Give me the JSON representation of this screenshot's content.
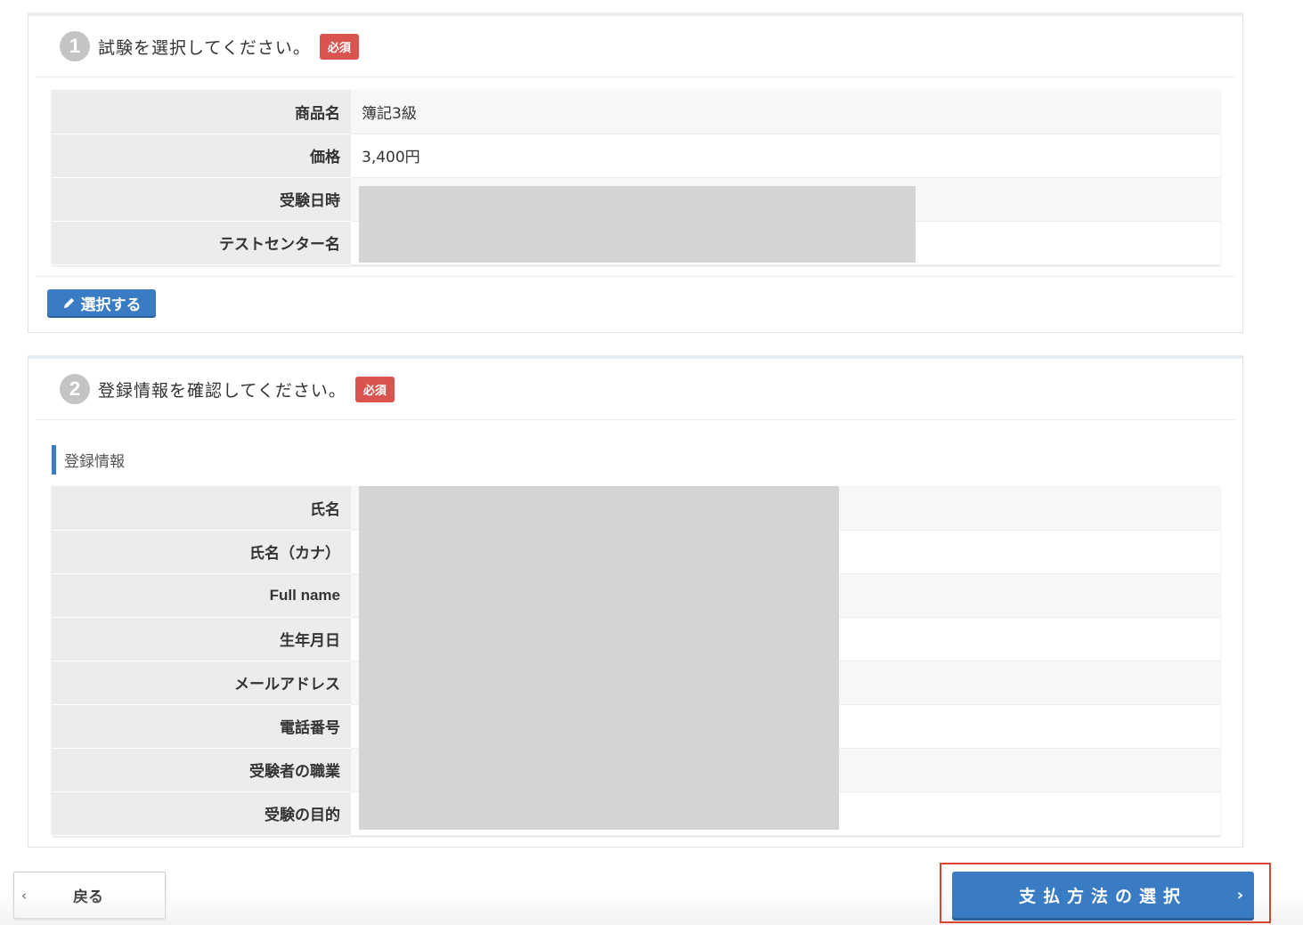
{
  "section1": {
    "step": "1",
    "title": "試験を選択してください。",
    "required": "必須",
    "rows": [
      {
        "label": "商品名",
        "value": "簿記3級"
      },
      {
        "label": "価格",
        "value": "3,400円"
      },
      {
        "label": "受験日時",
        "value": ""
      },
      {
        "label": "テストセンター名",
        "value": ""
      }
    ],
    "select_button": "選択する"
  },
  "section2": {
    "step": "2",
    "title": "登録情報を確認してください。",
    "required": "必須",
    "subheading": "登録情報",
    "rows": [
      {
        "label": "氏名"
      },
      {
        "label": "氏名（カナ）"
      },
      {
        "label": "Full name"
      },
      {
        "label": "生年月日"
      },
      {
        "label": "メールアドレス"
      },
      {
        "label": "電話番号"
      },
      {
        "label": "受験者の職業"
      },
      {
        "label": "受験の目的"
      }
    ]
  },
  "footer": {
    "back_label": "戻る",
    "pay_label": "支払方法の選択"
  },
  "colors": {
    "primary": "#3a7cc4",
    "required": "#d9534f",
    "highlight": "#d9452f"
  },
  "icons": {
    "back": "chevron-left-icon",
    "next": "chevron-right-icon",
    "select": "pencil-icon"
  }
}
